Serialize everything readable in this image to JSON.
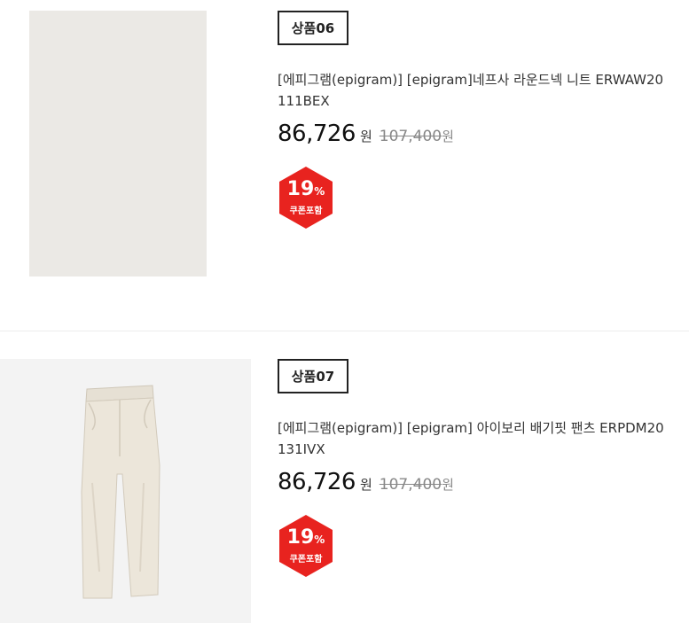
{
  "products": [
    {
      "tag": "상품06",
      "title": "[에피그램(epigram)] [epigram]네프사 라운드넥 니트 ERWAW20111BEX",
      "price": "86,726",
      "price_unit": "원",
      "original_price": "107,400",
      "original_unit": "원",
      "discount": "19",
      "discount_unit": "%",
      "coupon_label": "쿠폰포함",
      "image_icon": "model-knit-sweater-image"
    },
    {
      "tag": "상품07",
      "title": "[에피그램(epigram)] [epigram] 아이보리 배기핏 팬츠 ERPDM20131IVX",
      "price": "86,726",
      "price_unit": "원",
      "original_price": "107,400",
      "original_unit": "원",
      "discount": "19",
      "discount_unit": "%",
      "coupon_label": "쿠폰포함",
      "image_icon": "ivory-pants-image"
    }
  ],
  "colors": {
    "badge": "#e8231f",
    "text": "#222222",
    "strike": "#888888"
  }
}
